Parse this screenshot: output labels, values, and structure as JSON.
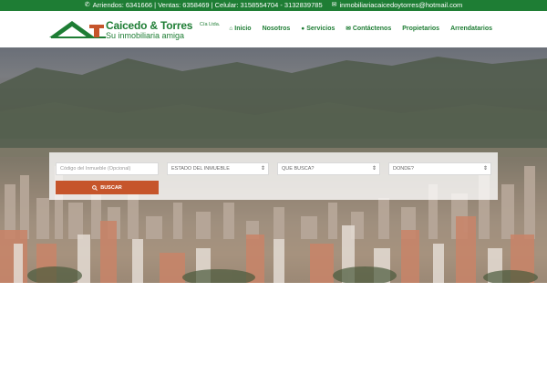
{
  "topbar": {
    "phone_icon": "phone-icon",
    "contact_text": "Arriendos: 6341666 | Ventas: 6358469 | Celular: 3158554704 - 3132839785",
    "email_icon": "envelope-icon",
    "email": "inmobiliariacaicedoytorres@hotmail.com"
  },
  "logo": {
    "name": "Caicedo & Torres",
    "company_suffix": "Cía Ltda.",
    "tagline": "Su inmobiliaria amiga"
  },
  "nav": {
    "items": [
      {
        "label": "Inicio",
        "icon": "home-icon"
      },
      {
        "label": "Nosotros",
        "icon": ""
      },
      {
        "label": "Servicios",
        "icon": "globe-icon"
      },
      {
        "label": "Contáctenos",
        "icon": "envelope-icon"
      },
      {
        "label": "Propietarios",
        "icon": ""
      },
      {
        "label": "Arrendatarios",
        "icon": ""
      }
    ]
  },
  "search": {
    "code_placeholder": "Código del Inmueble (Opcional)",
    "estado_selected": "ESTADO DEL INMUEBLE",
    "que_busca_selected": "QUE BUSCA?",
    "donde_selected": "DONDE?",
    "button_label": "BUSCAR",
    "button_icon": "search-icon"
  },
  "colors": {
    "brand_green": "#1e7d34",
    "button_orange": "#c6552b"
  }
}
